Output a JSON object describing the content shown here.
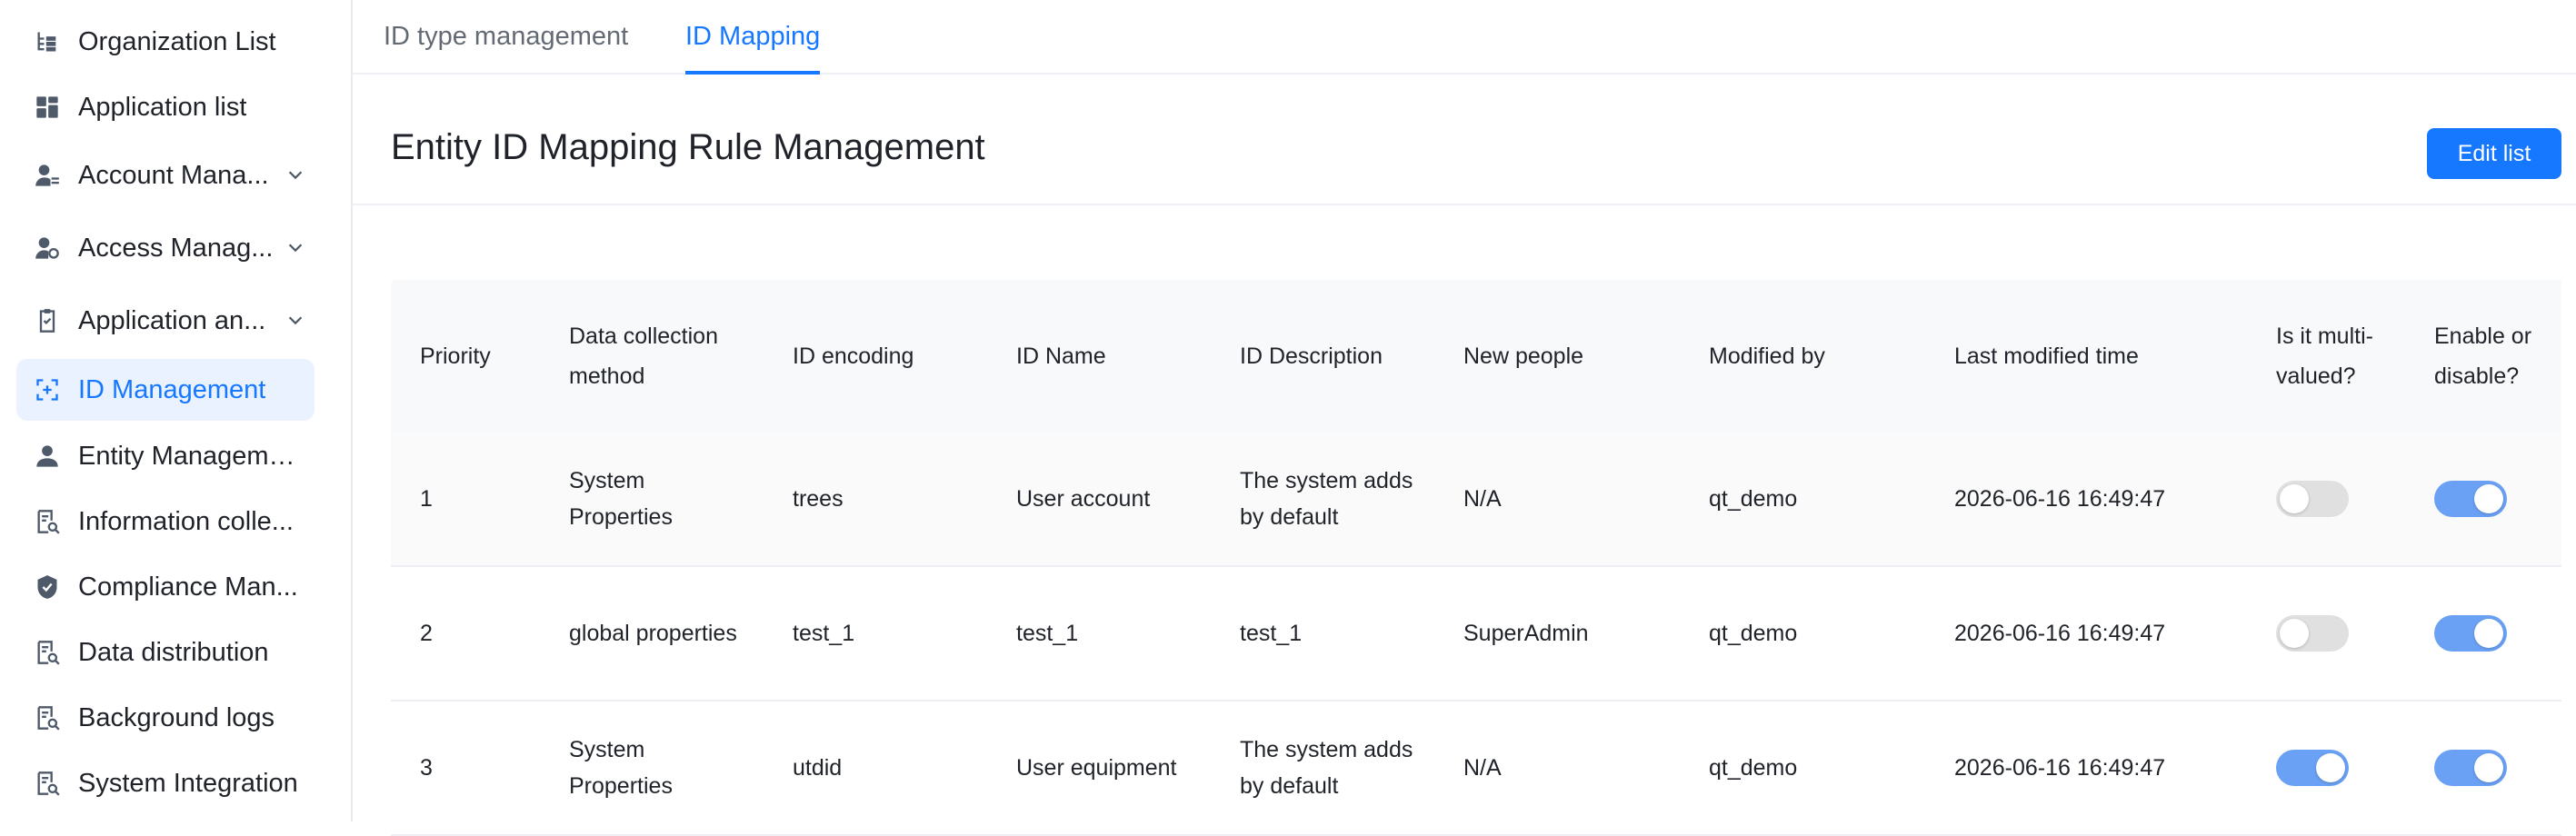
{
  "sidebar": {
    "items": [
      {
        "label": "Organization List",
        "icon": "org-tree-icon"
      },
      {
        "label": "Application list",
        "icon": "apps-grid-icon"
      },
      {
        "label": "Account Mana...",
        "icon": "account-icon"
      },
      {
        "label": "Access Manag...",
        "icon": "access-icon"
      },
      {
        "label": "Application an...",
        "icon": "clipboard-icon"
      },
      {
        "label": "ID Management",
        "icon": "id-icon"
      },
      {
        "label": "Entity Management",
        "icon": "person-icon"
      },
      {
        "label": "Information colle...",
        "icon": "doc-search-icon"
      },
      {
        "label": "Compliance Man...",
        "icon": "shield-icon"
      },
      {
        "label": "Data distribution",
        "icon": "doc-search-icon"
      },
      {
        "label": "Background logs",
        "icon": "doc-search-icon"
      },
      {
        "label": "System Integration",
        "icon": "doc-search-icon"
      }
    ]
  },
  "tabs": [
    {
      "label": "ID type management"
    },
    {
      "label": "ID Mapping"
    }
  ],
  "page": {
    "title": "Entity ID Mapping Rule Management",
    "edit_button": "Edit list"
  },
  "table": {
    "headers": {
      "priority": "Priority",
      "method": "Data collection method",
      "encoding": "ID encoding",
      "name": "ID Name",
      "description": "ID Description",
      "creator": "New people",
      "modifier": "Modified by",
      "modified_time": "Last modified time",
      "multi_valued": "Is it multi-valued?",
      "enabled": "Enable or disable?"
    },
    "rows": [
      {
        "priority": "1",
        "method": "System Properties",
        "encoding": "trees",
        "name": "User account",
        "description": "The system adds by default",
        "creator": "N/A",
        "modifier": "qt_demo",
        "modified_time": "2026-06-16 16:49:47",
        "multi_valued": false,
        "enabled": true
      },
      {
        "priority": "2",
        "method": "global properties",
        "encoding": "test_1",
        "name": "test_1",
        "description": "test_1",
        "creator": "SuperAdmin",
        "modifier": "qt_demo",
        "modified_time": "2026-06-16 16:49:47",
        "multi_valued": false,
        "enabled": true
      },
      {
        "priority": "3",
        "method": "System Properties",
        "encoding": "utdid",
        "name": "User equipment",
        "description": "The system adds by default",
        "creator": "N/A",
        "modifier": "qt_demo",
        "modified_time": "2026-06-16 16:49:47",
        "multi_valued": true,
        "enabled": true
      }
    ]
  },
  "colors": {
    "accent": "#1677ff",
    "toggle_on": "#6aa1f5",
    "toggle_off": "#e0e0e0",
    "active_nav_bg": "#e9f2fe"
  }
}
